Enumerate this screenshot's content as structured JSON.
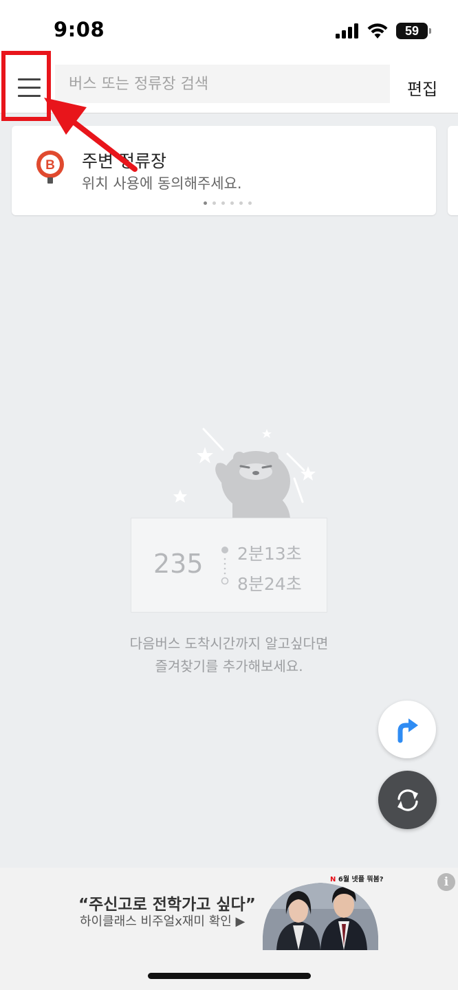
{
  "status_bar": {
    "time": "9:08",
    "battery": "59"
  },
  "top_bar": {
    "search_placeholder": "버스 또는 정류장 검색",
    "edit_label": "편집"
  },
  "nearby_card": {
    "title": "주변 정류장",
    "subtitle": "위치 사용에 동의해주세요.",
    "icon_letter": "B",
    "page_count": 6,
    "active_page": 1
  },
  "empty_state": {
    "sample_route": "235",
    "sample_time_1": "2분13초",
    "sample_time_2": "8분24초",
    "message_line1": "다음버스 도착시간까지 알고싶다면",
    "message_line2": "즐겨찾기를 추가해보세요."
  },
  "ad": {
    "title": "“주신고로 전학가고 싶다”",
    "subtitle": "하이클래스 비주얼x재미 확인 ▶",
    "tag_n": "N",
    "tag_text": "6월 넷플 뭐봄?",
    "info_label": "i"
  },
  "colors": {
    "annotation_red": "#e8151b",
    "stop_icon_red": "#e04a2f",
    "directions_blue": "#2f8cf3",
    "refresh_bg": "#4a4c4f"
  }
}
